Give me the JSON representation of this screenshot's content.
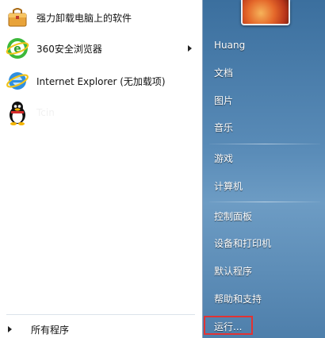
{
  "programs": [
    {
      "label": "强力卸载电脑上的软件",
      "icon": "uninstaller-icon"
    },
    {
      "label": "360安全浏览器",
      "icon": "360-browser-icon"
    },
    {
      "label": "Internet Explorer (无加载项)",
      "icon": "internet-explorer-icon"
    },
    {
      "label": "Tcin",
      "icon": "qq-penguin-icon"
    }
  ],
  "all_programs_label": "所有程序",
  "right_menu": {
    "user": "Huang",
    "documents": "文档",
    "pictures": "图片",
    "music": "音乐",
    "games": "游戏",
    "computer": "计算机",
    "control_panel": "控制面板",
    "devices_printers": "设备和打印机",
    "default_programs": "默认程序",
    "help_support": "帮助和支持",
    "run": "运行..."
  },
  "colors": {
    "highlight_border": "#e23333",
    "right_pane_blue": "#5a8cb8"
  }
}
